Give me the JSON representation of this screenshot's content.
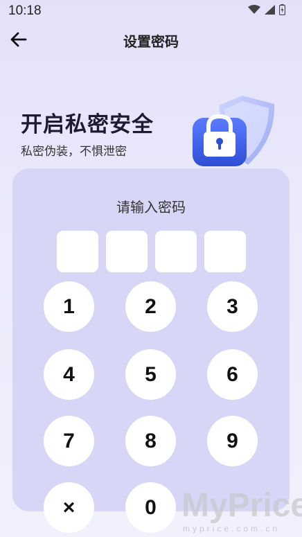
{
  "status": {
    "time": "10:18"
  },
  "header": {
    "title": "设置密码"
  },
  "hero": {
    "title": "开启私密安全",
    "subtitle": "私密伪装，不惧泄密"
  },
  "keypad": {
    "prompt": "请输入密码",
    "pin_length": 4,
    "keys": [
      "1",
      "2",
      "3",
      "4",
      "5",
      "6",
      "7",
      "8",
      "9",
      "×",
      "0"
    ]
  },
  "watermark": {
    "brand": "MyPrice",
    "site": "myprice.com.cn"
  },
  "colors": {
    "accent": "#3b5bdb",
    "card": "#d8d6f7",
    "background": "#ebe9fb"
  }
}
